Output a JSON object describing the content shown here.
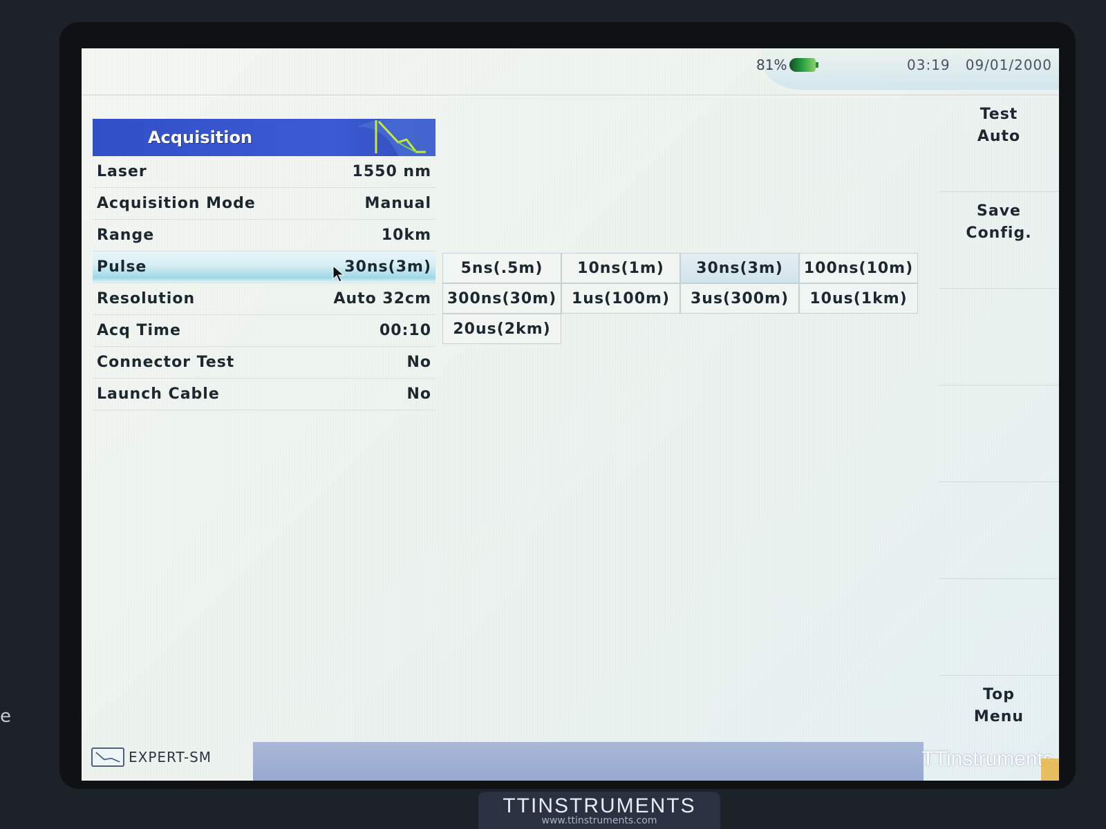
{
  "status": {
    "battery_percent": "81%",
    "time": "03:19",
    "date": "09/01/2000"
  },
  "panel": {
    "title": "Acquisition",
    "rows": [
      {
        "label": "Laser",
        "value": "1550 nm"
      },
      {
        "label": "Acquisition Mode",
        "value": "Manual"
      },
      {
        "label": "Range",
        "value": "10km"
      },
      {
        "label": "Pulse",
        "value": "30ns(3m)"
      },
      {
        "label": "Resolution",
        "value": "Auto 32cm"
      },
      {
        "label": "Acq Time",
        "value": "00:10"
      },
      {
        "label": "Connector Test",
        "value": "No"
      },
      {
        "label": "Launch Cable",
        "value": "No"
      }
    ]
  },
  "pulse_options": [
    "5ns(.5m)",
    "10ns(1m)",
    "30ns(3m)",
    "100ns(10m)",
    "300ns(30m)",
    "1us(100m)",
    "3us(300m)",
    "10us(1km)",
    "20us(2km)"
  ],
  "softkeys": {
    "test_auto": [
      "Test",
      "Auto"
    ],
    "save_config": [
      "Save",
      "Config."
    ],
    "top_menu": [
      "Top",
      "Menu"
    ]
  },
  "footer": {
    "mode": "EXPERT-SM",
    "brand": "TTinstruments"
  },
  "bezel": {
    "brand": "TTINSTRUMENTS",
    "url": "www.ttinstruments.com",
    "edge_label": "e"
  },
  "colors": {
    "header_blue": "#3150c8",
    "selected_row": "#9fd8e6",
    "footer_bar": "#a9b8d8"
  }
}
